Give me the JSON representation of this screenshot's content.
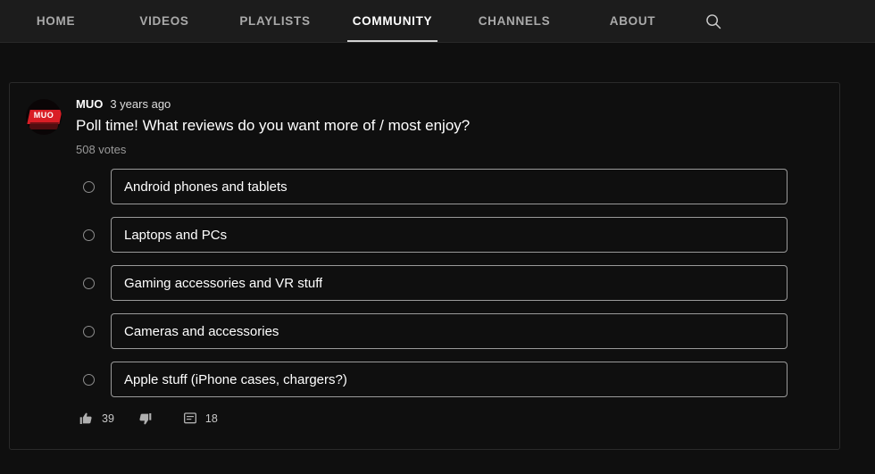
{
  "navbar": {
    "tabs": [
      {
        "label": "HOME",
        "active": false
      },
      {
        "label": "VIDEOS",
        "active": false
      },
      {
        "label": "PLAYLISTS",
        "active": false
      },
      {
        "label": "COMMUNITY",
        "active": true
      },
      {
        "label": "CHANNELS",
        "active": false
      },
      {
        "label": "ABOUT",
        "active": false
      }
    ],
    "search_icon": "search-icon"
  },
  "post": {
    "avatar_text": "MUO",
    "author": "MUO",
    "timestamp": "3 years ago",
    "question": "Poll time! What reviews do you want more of / most enjoy?",
    "votes": "508 votes",
    "options": [
      {
        "label": "Android phones and tablets"
      },
      {
        "label": "Laptops and PCs"
      },
      {
        "label": "Gaming accessories and VR stuff"
      },
      {
        "label": "Cameras and accessories"
      },
      {
        "label": "Apple stuff (iPhone cases, chargers?)"
      }
    ],
    "actions": {
      "like_count": "39",
      "dislike_count": "",
      "comment_count": "18"
    }
  },
  "colors": {
    "background": "#0f0f0f",
    "navbar_background": "#1c1c1c",
    "active_tab": "#ffffff",
    "inactive_tab": "#aaaaaa",
    "underline": "#d2d2d2",
    "card_border": "#2a2a2a",
    "option_border": "#9a9a9a",
    "brand_red": "#d91e26"
  }
}
